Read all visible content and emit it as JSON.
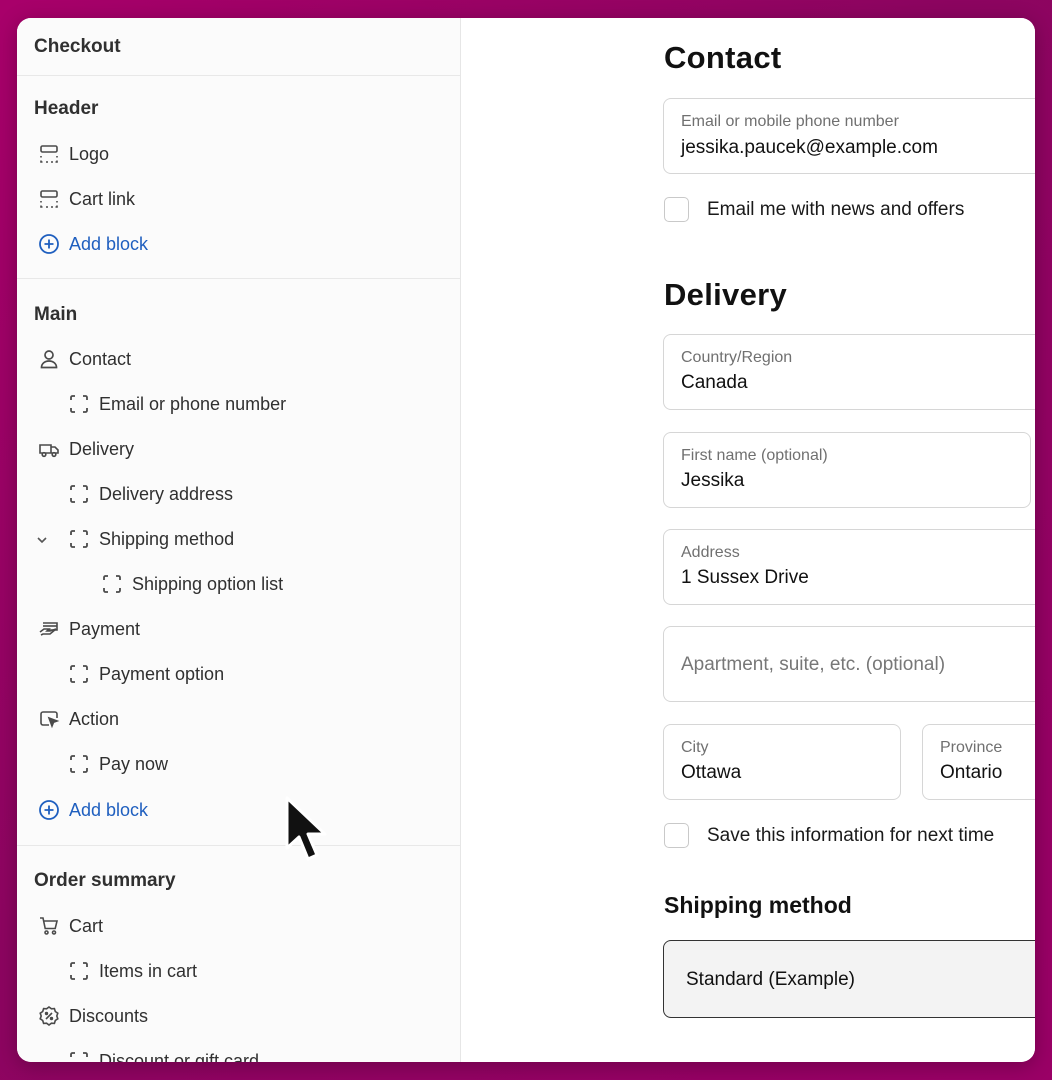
{
  "sidebar": {
    "title": "Checkout",
    "sections": {
      "header": {
        "title": "Header",
        "items": [
          {
            "label": "Logo",
            "icon": "layout-block-icon"
          },
          {
            "label": "Cart link",
            "icon": "layout-block-icon"
          },
          {
            "label": "Add block",
            "icon": "plus-circle-icon"
          }
        ]
      },
      "main": {
        "title": "Main",
        "items": [
          {
            "label": "Contact",
            "icon": "person-icon"
          },
          {
            "label": "Email or phone number",
            "icon": "dashed-square-icon"
          },
          {
            "label": "Delivery",
            "icon": "truck-icon"
          },
          {
            "label": "Delivery address",
            "icon": "dashed-square-icon"
          },
          {
            "label": "Shipping method",
            "icon": "dashed-square-icon"
          },
          {
            "label": "Shipping option list",
            "icon": "dashed-square-icon"
          },
          {
            "label": "Payment",
            "icon": "card-hand-icon"
          },
          {
            "label": "Payment option",
            "icon": "dashed-square-icon"
          },
          {
            "label": "Action",
            "icon": "cursor-click-icon"
          },
          {
            "label": "Pay now",
            "icon": "dashed-square-icon"
          },
          {
            "label": "Add block",
            "icon": "plus-circle-icon"
          }
        ]
      },
      "order_summary": {
        "title": "Order summary",
        "items": [
          {
            "label": "Cart",
            "icon": "cart-icon"
          },
          {
            "label": "Items in cart",
            "icon": "dashed-square-icon"
          },
          {
            "label": "Discounts",
            "icon": "discount-badge-icon"
          },
          {
            "label": "Discount or gift card",
            "icon": "dashed-square-icon"
          }
        ]
      }
    }
  },
  "checkout": {
    "contact": {
      "heading": "Contact",
      "email_label": "Email or mobile phone number",
      "email_value": "jessika.paucek@example.com",
      "news_checkbox": "Email me with news and offers"
    },
    "delivery": {
      "heading": "Delivery",
      "country_label": "Country/Region",
      "country_value": "Canada",
      "first_name_label": "First name (optional)",
      "first_name_value": "Jessika",
      "address_label": "Address",
      "address_value": "1 Sussex Drive",
      "apartment_placeholder": "Apartment, suite, etc. (optional)",
      "city_label": "City",
      "city_value": "Ottawa",
      "province_label": "Province",
      "province_value": "Ontario",
      "save_checkbox": "Save this information for next time"
    },
    "shipping": {
      "heading": "Shipping method",
      "option": "Standard (Example)"
    }
  },
  "colors": {
    "background": "#a8006a",
    "link_blue": "#1f5fbf",
    "text": "#303030"
  }
}
